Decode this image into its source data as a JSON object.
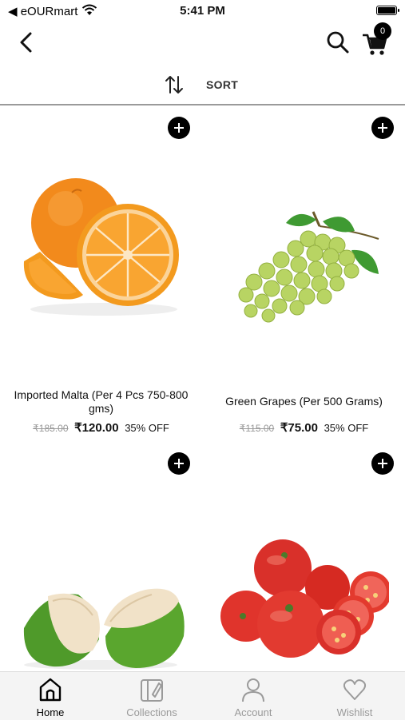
{
  "status_bar": {
    "carrier": "◀ eOURmart",
    "time": "5:41 PM"
  },
  "header": {
    "cart_count": "0"
  },
  "sort": {
    "label": "SORT"
  },
  "products": [
    {
      "name": "Imported Malta (Per 4 Pcs 750-800 gms)",
      "mrp": "₹185.00",
      "price": "₹120.00",
      "discount": "35% OFF",
      "image": "orange"
    },
    {
      "name": "Green Grapes (Per 500 Grams)",
      "mrp": "₹115.00",
      "price": "₹75.00",
      "discount": "35% OFF",
      "image": "green-grapes"
    },
    {
      "name": "",
      "mrp": "",
      "price": "",
      "discount": "",
      "image": "tender-coconut"
    },
    {
      "name": "",
      "mrp": "",
      "price": "",
      "discount": "",
      "image": "tomatoes"
    }
  ],
  "tabs": [
    {
      "label": "Home",
      "icon": "home-icon",
      "active": true
    },
    {
      "label": "Collections",
      "icon": "collections-icon",
      "active": false
    },
    {
      "label": "Account",
      "icon": "account-icon",
      "active": false
    },
    {
      "label": "Wishlist",
      "icon": "heart-icon",
      "active": false
    }
  ],
  "colors": {
    "accent": "#000000",
    "inactive_tab": "#9a9a9a",
    "tab_bar_bg": "#f4f4f4",
    "strike_price": "#999999"
  }
}
